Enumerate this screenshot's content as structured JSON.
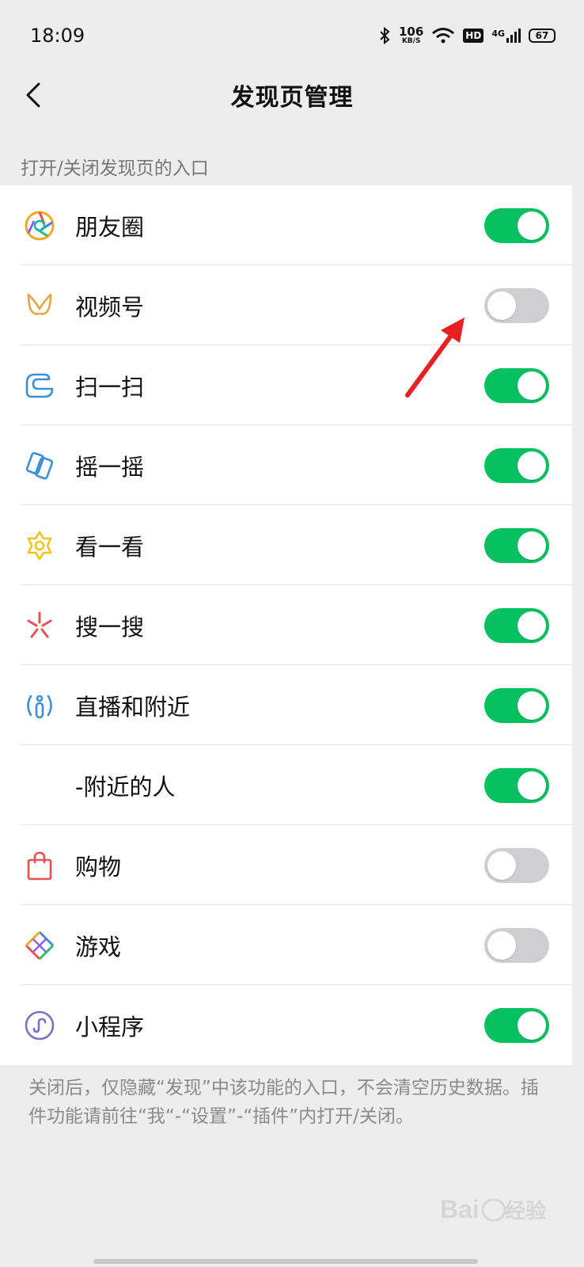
{
  "status_bar": {
    "time": "18:09",
    "net_speed_value": "106",
    "net_speed_unit": "KB/S",
    "hd_badge": "HD",
    "network_type": "4G",
    "battery": "67"
  },
  "nav": {
    "title": "发现页管理"
  },
  "section_label": "打开/关闭发现页的入口",
  "items": [
    {
      "label": "朋友圈",
      "enabled": true,
      "icon": "moments-icon"
    },
    {
      "label": "视频号",
      "enabled": false,
      "icon": "channels-icon"
    },
    {
      "label": "扫一扫",
      "enabled": true,
      "icon": "scan-icon"
    },
    {
      "label": "摇一摇",
      "enabled": true,
      "icon": "shake-icon"
    },
    {
      "label": "看一看",
      "enabled": true,
      "icon": "top-stories-icon"
    },
    {
      "label": "搜一搜",
      "enabled": true,
      "icon": "search-icon"
    },
    {
      "label": "直播和附近",
      "enabled": true,
      "icon": "live-nearby-icon"
    },
    {
      "label": "-附近的人",
      "enabled": true,
      "icon": null
    },
    {
      "label": "购物",
      "enabled": false,
      "icon": "shopping-bag-icon"
    },
    {
      "label": "游戏",
      "enabled": false,
      "icon": "games-icon"
    },
    {
      "label": "小程序",
      "enabled": true,
      "icon": "mini-programs-icon"
    }
  ],
  "footer_note": "关闭后，仅隐藏“发现”中该功能的入口，不会清空历史数据。插件功能请前往“我“-“设置”-“插件”内打开/关闭。",
  "watermark": "Baidu经验",
  "colors": {
    "toggle_on": "#07c160",
    "toggle_off": "#cfcfd1",
    "background": "#ededed"
  }
}
